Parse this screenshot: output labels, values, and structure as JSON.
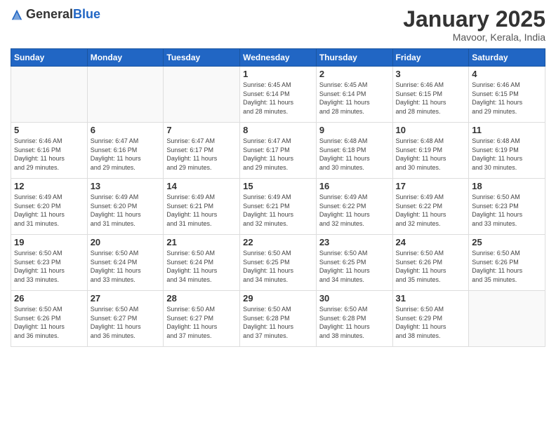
{
  "logo": {
    "general": "General",
    "blue": "Blue"
  },
  "header": {
    "month": "January 2025",
    "location": "Mavoor, Kerala, India"
  },
  "weekdays": [
    "Sunday",
    "Monday",
    "Tuesday",
    "Wednesday",
    "Thursday",
    "Friday",
    "Saturday"
  ],
  "weeks": [
    [
      {
        "day": "",
        "info": ""
      },
      {
        "day": "",
        "info": ""
      },
      {
        "day": "",
        "info": ""
      },
      {
        "day": "1",
        "info": "Sunrise: 6:45 AM\nSunset: 6:14 PM\nDaylight: 11 hours\nand 28 minutes."
      },
      {
        "day": "2",
        "info": "Sunrise: 6:45 AM\nSunset: 6:14 PM\nDaylight: 11 hours\nand 28 minutes."
      },
      {
        "day": "3",
        "info": "Sunrise: 6:46 AM\nSunset: 6:15 PM\nDaylight: 11 hours\nand 28 minutes."
      },
      {
        "day": "4",
        "info": "Sunrise: 6:46 AM\nSunset: 6:15 PM\nDaylight: 11 hours\nand 29 minutes."
      }
    ],
    [
      {
        "day": "5",
        "info": "Sunrise: 6:46 AM\nSunset: 6:16 PM\nDaylight: 11 hours\nand 29 minutes."
      },
      {
        "day": "6",
        "info": "Sunrise: 6:47 AM\nSunset: 6:16 PM\nDaylight: 11 hours\nand 29 minutes."
      },
      {
        "day": "7",
        "info": "Sunrise: 6:47 AM\nSunset: 6:17 PM\nDaylight: 11 hours\nand 29 minutes."
      },
      {
        "day": "8",
        "info": "Sunrise: 6:47 AM\nSunset: 6:17 PM\nDaylight: 11 hours\nand 29 minutes."
      },
      {
        "day": "9",
        "info": "Sunrise: 6:48 AM\nSunset: 6:18 PM\nDaylight: 11 hours\nand 30 minutes."
      },
      {
        "day": "10",
        "info": "Sunrise: 6:48 AM\nSunset: 6:19 PM\nDaylight: 11 hours\nand 30 minutes."
      },
      {
        "day": "11",
        "info": "Sunrise: 6:48 AM\nSunset: 6:19 PM\nDaylight: 11 hours\nand 30 minutes."
      }
    ],
    [
      {
        "day": "12",
        "info": "Sunrise: 6:49 AM\nSunset: 6:20 PM\nDaylight: 11 hours\nand 31 minutes."
      },
      {
        "day": "13",
        "info": "Sunrise: 6:49 AM\nSunset: 6:20 PM\nDaylight: 11 hours\nand 31 minutes."
      },
      {
        "day": "14",
        "info": "Sunrise: 6:49 AM\nSunset: 6:21 PM\nDaylight: 11 hours\nand 31 minutes."
      },
      {
        "day": "15",
        "info": "Sunrise: 6:49 AM\nSunset: 6:21 PM\nDaylight: 11 hours\nand 32 minutes."
      },
      {
        "day": "16",
        "info": "Sunrise: 6:49 AM\nSunset: 6:22 PM\nDaylight: 11 hours\nand 32 minutes."
      },
      {
        "day": "17",
        "info": "Sunrise: 6:49 AM\nSunset: 6:22 PM\nDaylight: 11 hours\nand 32 minutes."
      },
      {
        "day": "18",
        "info": "Sunrise: 6:50 AM\nSunset: 6:23 PM\nDaylight: 11 hours\nand 33 minutes."
      }
    ],
    [
      {
        "day": "19",
        "info": "Sunrise: 6:50 AM\nSunset: 6:23 PM\nDaylight: 11 hours\nand 33 minutes."
      },
      {
        "day": "20",
        "info": "Sunrise: 6:50 AM\nSunset: 6:24 PM\nDaylight: 11 hours\nand 33 minutes."
      },
      {
        "day": "21",
        "info": "Sunrise: 6:50 AM\nSunset: 6:24 PM\nDaylight: 11 hours\nand 34 minutes."
      },
      {
        "day": "22",
        "info": "Sunrise: 6:50 AM\nSunset: 6:25 PM\nDaylight: 11 hours\nand 34 minutes."
      },
      {
        "day": "23",
        "info": "Sunrise: 6:50 AM\nSunset: 6:25 PM\nDaylight: 11 hours\nand 34 minutes."
      },
      {
        "day": "24",
        "info": "Sunrise: 6:50 AM\nSunset: 6:26 PM\nDaylight: 11 hours\nand 35 minutes."
      },
      {
        "day": "25",
        "info": "Sunrise: 6:50 AM\nSunset: 6:26 PM\nDaylight: 11 hours\nand 35 minutes."
      }
    ],
    [
      {
        "day": "26",
        "info": "Sunrise: 6:50 AM\nSunset: 6:26 PM\nDaylight: 11 hours\nand 36 minutes."
      },
      {
        "day": "27",
        "info": "Sunrise: 6:50 AM\nSunset: 6:27 PM\nDaylight: 11 hours\nand 36 minutes."
      },
      {
        "day": "28",
        "info": "Sunrise: 6:50 AM\nSunset: 6:27 PM\nDaylight: 11 hours\nand 37 minutes."
      },
      {
        "day": "29",
        "info": "Sunrise: 6:50 AM\nSunset: 6:28 PM\nDaylight: 11 hours\nand 37 minutes."
      },
      {
        "day": "30",
        "info": "Sunrise: 6:50 AM\nSunset: 6:28 PM\nDaylight: 11 hours\nand 38 minutes."
      },
      {
        "day": "31",
        "info": "Sunrise: 6:50 AM\nSunset: 6:29 PM\nDaylight: 11 hours\nand 38 minutes."
      },
      {
        "day": "",
        "info": ""
      }
    ]
  ]
}
